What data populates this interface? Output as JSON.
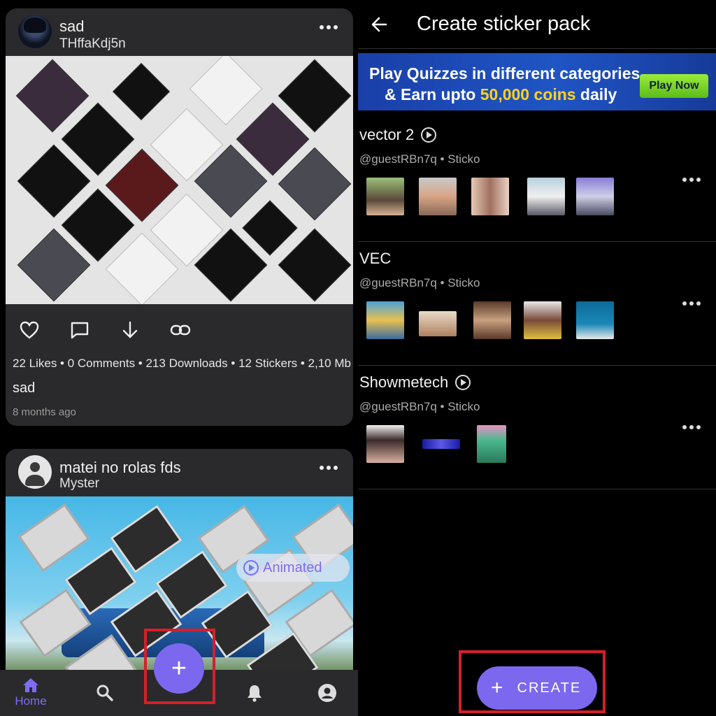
{
  "feed": {
    "posts": [
      {
        "user_name": "sad",
        "handle": "THffaKdj5n",
        "stats": "22 Likes • 0 Comments • 213 Downloads • 12 Stickers • 2,10 Mb",
        "caption": "sad",
        "time_ago": "8 months ago"
      },
      {
        "user_name": "matei no rolas fds",
        "handle": "Myster",
        "badge": "Animated"
      }
    ]
  },
  "bottom_nav": {
    "home_label": "Home",
    "fab_symbol": "+"
  },
  "create_screen": {
    "title": "Create sticker pack",
    "ad": {
      "line1": "Play Quizzes in different categories",
      "line2_prefix": "& Earn upto ",
      "line2_highlight": "50,000 coins",
      "line2_suffix": " daily",
      "cta": "Play Now"
    },
    "packs": [
      {
        "name": "vector 2",
        "meta": "@guestRBn7q • Sticko",
        "animated": true
      },
      {
        "name": "VEC",
        "meta": "@guestRBn7q • Sticko",
        "animated": false
      },
      {
        "name": "Showmetech",
        "meta": "@guestRBn7q • Sticko",
        "animated": true
      }
    ],
    "create_plus": "+",
    "create_label": "CREATE"
  },
  "colors": {
    "accent": "#7b68ee",
    "highlight_box": "#d4202a",
    "card_bg": "#2a2a2c"
  }
}
